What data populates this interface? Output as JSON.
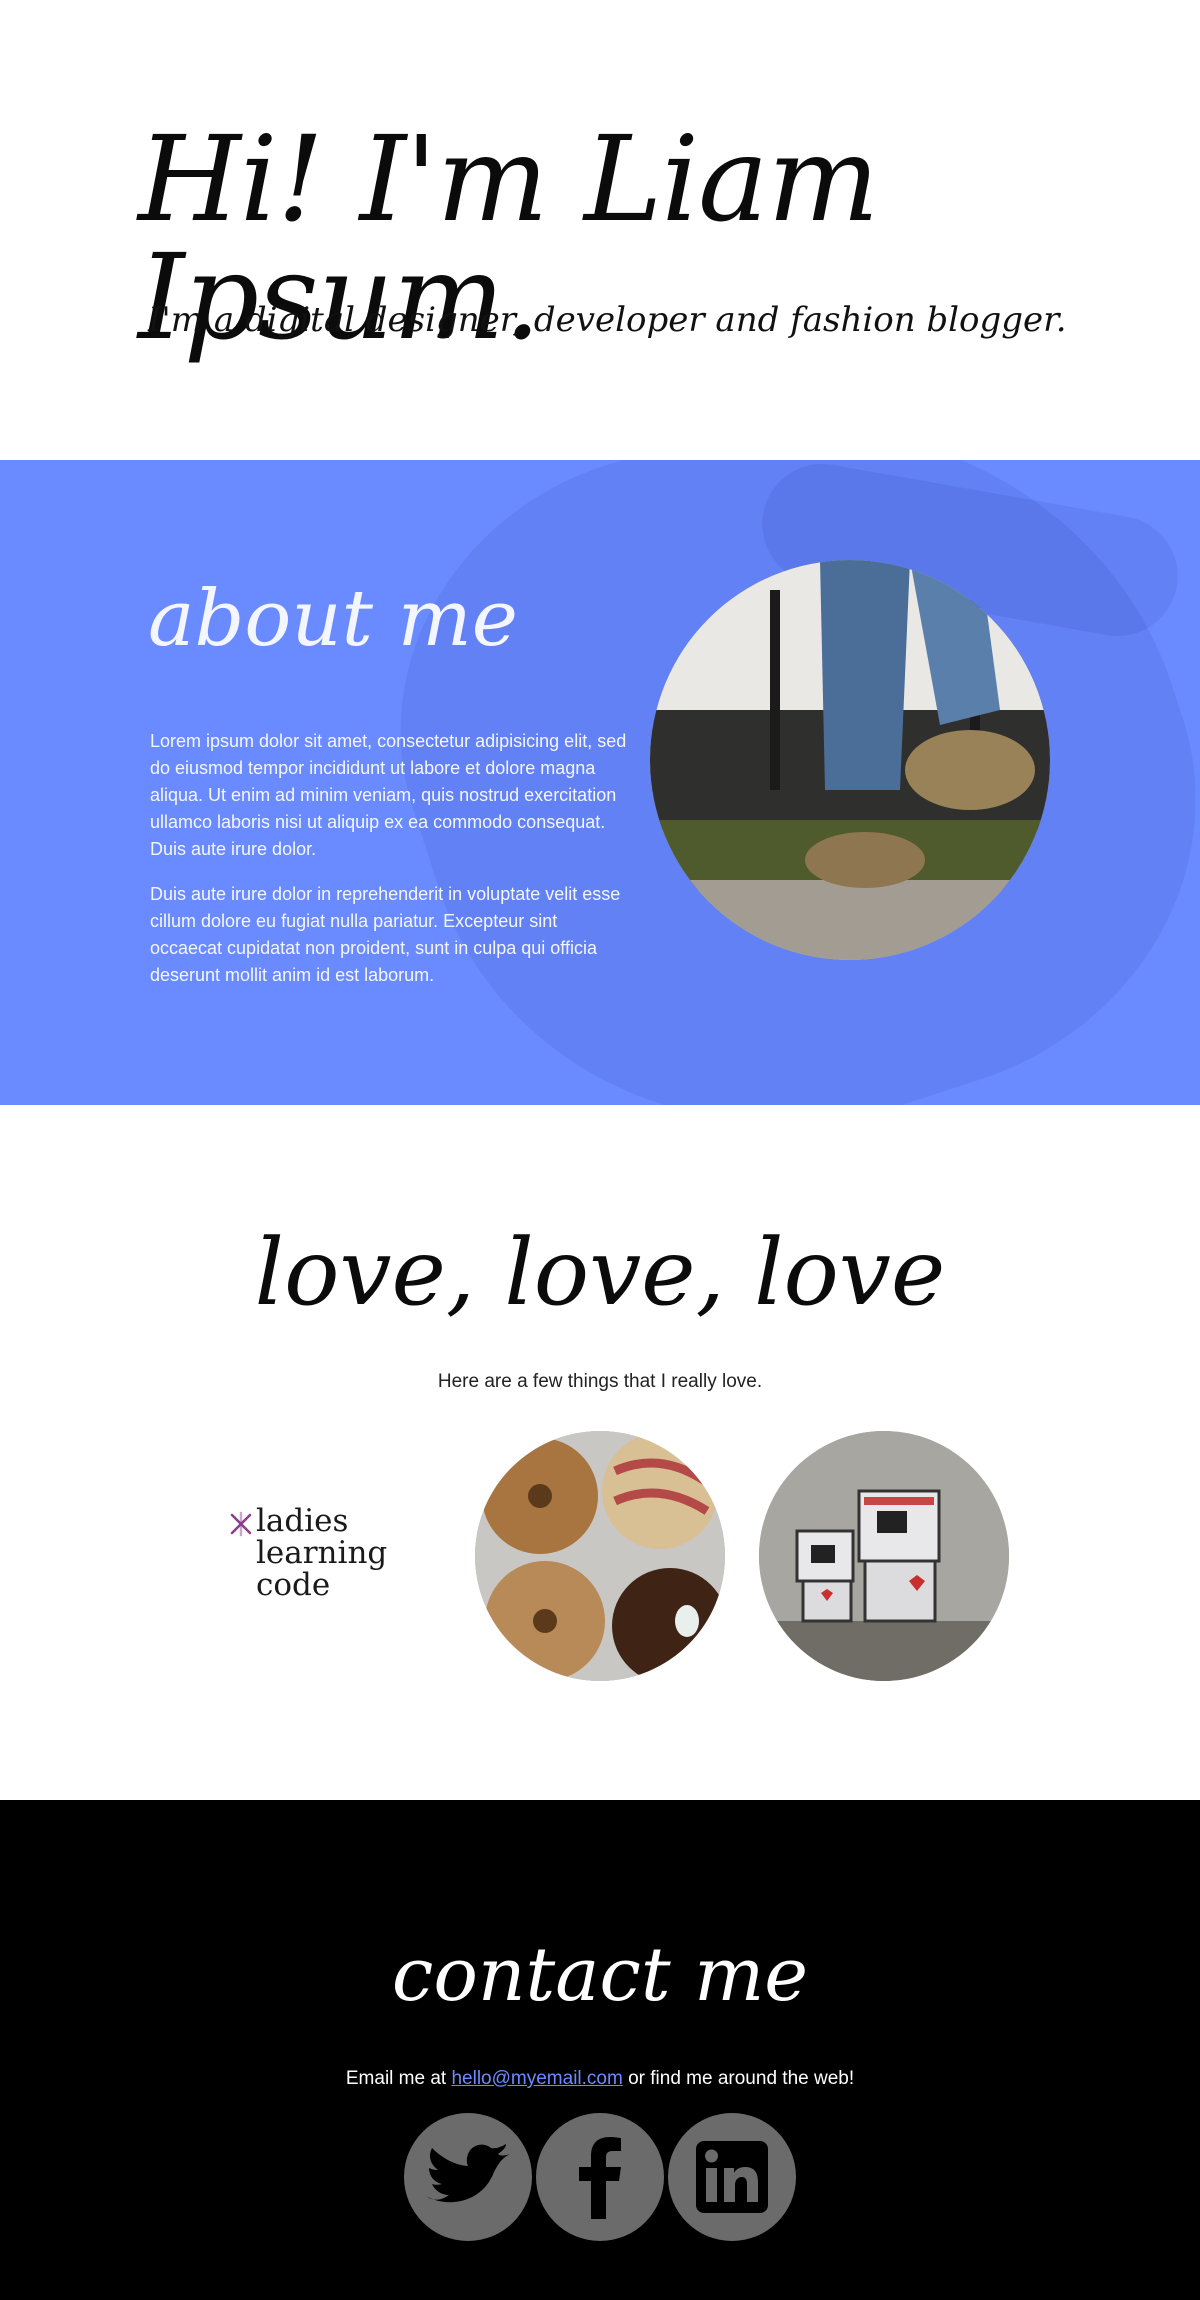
{
  "hero": {
    "title": "Hi! I'm Liam Ipsum.",
    "subtitle": "I'm a digital designer, developer and fashion blogger."
  },
  "about": {
    "heading": "about me",
    "paragraphs": [
      "Lorem ipsum dolor sit amet, consectetur adipisicing elit, sed do eiusmod tempor incididunt ut labore et dolore magna aliqua. Ut enim ad minim veniam, quis nostrud exercitation ullamco laboris nisi ut aliquip ex ea commodo consequat. Duis aute irure dolor.",
      "Duis aute irure dolor in reprehenderit in voluptate velit esse cillum dolore eu fugiat nulla pariatur. Excepteur sint occaecat cupidatat non proident, sunt in culpa qui officia deserunt mollit anim id est laborum."
    ],
    "background_color": "#6a8bff"
  },
  "love": {
    "heading": "love, love, love",
    "intro": "Here are a few things that I really love.",
    "logo": {
      "name": "ladies learning code",
      "lines": [
        "ladies",
        "learning",
        "code"
      ]
    }
  },
  "contact": {
    "heading": "contact me",
    "line_prefix": "Email me at ",
    "email": "hello@myemail.com",
    "line_suffix": " or find me around the web!",
    "socials": [
      {
        "icon": "twitter-icon"
      },
      {
        "icon": "facebook-icon"
      },
      {
        "icon": "linkedin-icon"
      }
    ]
  },
  "colors": {
    "accent": "#6a8bff",
    "social_circle": "#6b6b6b",
    "footer_bg": "#000000"
  }
}
